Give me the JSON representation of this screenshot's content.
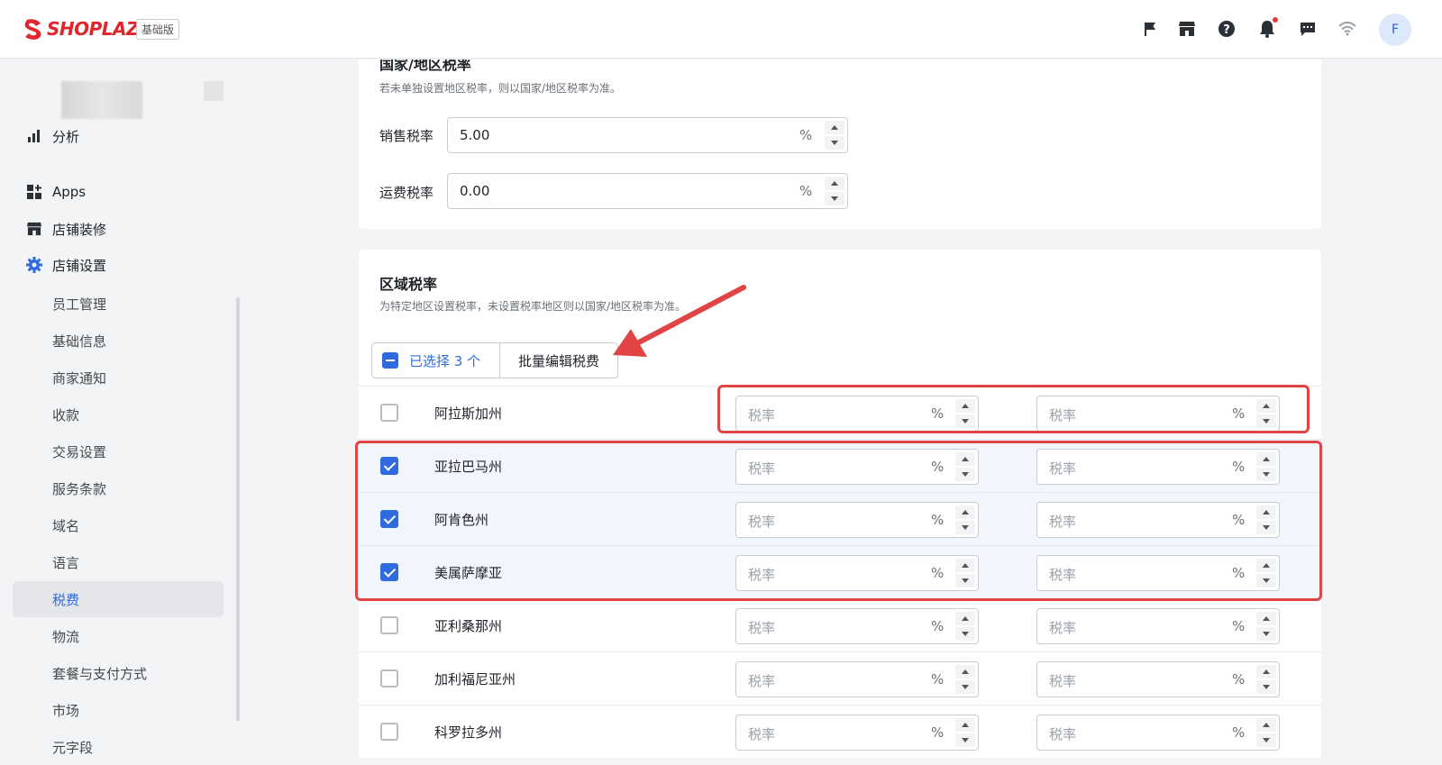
{
  "topbar": {
    "brand": "SHOPLAZZA",
    "plan_badge": "基础版",
    "avatar_initial": "F",
    "icons": [
      "flag-icon",
      "store-icon",
      "help-icon",
      "bell-icon",
      "chat-icon",
      "wifi-icon"
    ]
  },
  "sidebar": {
    "items": [
      {
        "label": "分析",
        "icon": "bar-chart-icon"
      },
      {
        "label": "Apps",
        "icon": "apps-icon"
      },
      {
        "label": "店铺装修",
        "icon": "store-icon"
      },
      {
        "label": "店铺设置",
        "icon": "gear-icon"
      }
    ],
    "sub_items": [
      "员工管理",
      "基础信息",
      "商家通知",
      "收款",
      "交易设置",
      "服务条款",
      "域名",
      "语言",
      "税费",
      "物流",
      "套餐与支付方式",
      "市场",
      "元字段"
    ],
    "active_sub": "税费"
  },
  "country_tax": {
    "title": "国家/地区税率",
    "description": "若未单独设置地区税率，则以国家/地区税率为准。",
    "sales_label": "销售税率",
    "sales_value": "5.00",
    "shipping_label": "运费税率",
    "shipping_value": "0.00",
    "unit": "%"
  },
  "regional_tax": {
    "title": "区域税率",
    "description": "为特定地区设置税率，未设置税率地区则以国家/地区税率为准。",
    "selected_text": "已选择 3 个",
    "bulk_edit_label": "批量编辑税费",
    "placeholder": "税率",
    "unit": "%",
    "rows": [
      {
        "name": "阿拉斯加州",
        "checked": false
      },
      {
        "name": "亚拉巴马州",
        "checked": true
      },
      {
        "name": "阿肯色州",
        "checked": true
      },
      {
        "name": "美属萨摩亚",
        "checked": true
      },
      {
        "name": "亚利桑那州",
        "checked": false
      },
      {
        "name": "加利福尼亚州",
        "checked": false
      },
      {
        "name": "科罗拉多州",
        "checked": false
      }
    ]
  },
  "colors": {
    "accent": "#2f6bde",
    "annotation_red": "#e04444",
    "brand_red": "#e0262d"
  }
}
